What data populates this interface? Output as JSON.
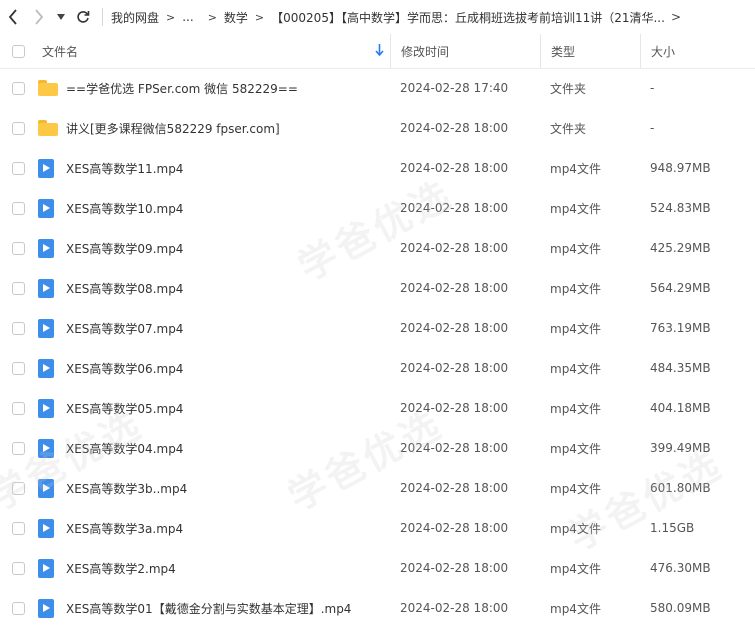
{
  "nav": {
    "breadcrumbs": [
      "我的网盘",
      "...",
      "数学",
      "【000205】【高中数学】学而思：丘成桐班选拔考前培训11讲（21清华..."
    ]
  },
  "columns": {
    "name": "文件名",
    "time": "修改时间",
    "type": "类型",
    "size": "大小"
  },
  "files": [
    {
      "name": "==学爸优选 FPSer.com 微信 582229==",
      "time": "2024-02-28 17:40",
      "type": "文件夹",
      "size": "-",
      "kind": "folder"
    },
    {
      "name": "讲义[更多课程微信582229 fpser.com]",
      "time": "2024-02-28 18:00",
      "type": "文件夹",
      "size": "-",
      "kind": "folder"
    },
    {
      "name": "XES高等数学11.mp4",
      "time": "2024-02-28 18:00",
      "type": "mp4文件",
      "size": "948.97MB",
      "kind": "video"
    },
    {
      "name": "XES高等数学10.mp4",
      "time": "2024-02-28 18:00",
      "type": "mp4文件",
      "size": "524.83MB",
      "kind": "video"
    },
    {
      "name": "XES高等数学09.mp4",
      "time": "2024-02-28 18:00",
      "type": "mp4文件",
      "size": "425.29MB",
      "kind": "video"
    },
    {
      "name": "XES高等数学08.mp4",
      "time": "2024-02-28 18:00",
      "type": "mp4文件",
      "size": "564.29MB",
      "kind": "video"
    },
    {
      "name": "XES高等数学07.mp4",
      "time": "2024-02-28 18:00",
      "type": "mp4文件",
      "size": "763.19MB",
      "kind": "video"
    },
    {
      "name": "XES高等数学06.mp4",
      "time": "2024-02-28 18:00",
      "type": "mp4文件",
      "size": "484.35MB",
      "kind": "video"
    },
    {
      "name": "XES高等数学05.mp4",
      "time": "2024-02-28 18:00",
      "type": "mp4文件",
      "size": "404.18MB",
      "kind": "video"
    },
    {
      "name": "XES高等数学04.mp4",
      "time": "2024-02-28 18:00",
      "type": "mp4文件",
      "size": "399.49MB",
      "kind": "video"
    },
    {
      "name": "XES高等数学3b..mp4",
      "time": "2024-02-28 18:00",
      "type": "mp4文件",
      "size": "601.80MB",
      "kind": "video"
    },
    {
      "name": "XES高等数学3a.mp4",
      "time": "2024-02-28 18:00",
      "type": "mp4文件",
      "size": "1.15GB",
      "kind": "video"
    },
    {
      "name": "XES高等数学2.mp4",
      "time": "2024-02-28 18:00",
      "type": "mp4文件",
      "size": "476.30MB",
      "kind": "video"
    },
    {
      "name": "XES高等数学01【戴德金分割与实数基本定理】.mp4",
      "time": "2024-02-28 18:00",
      "type": "mp4文件",
      "size": "580.09MB",
      "kind": "video"
    }
  ],
  "watermark": "学爸优选"
}
